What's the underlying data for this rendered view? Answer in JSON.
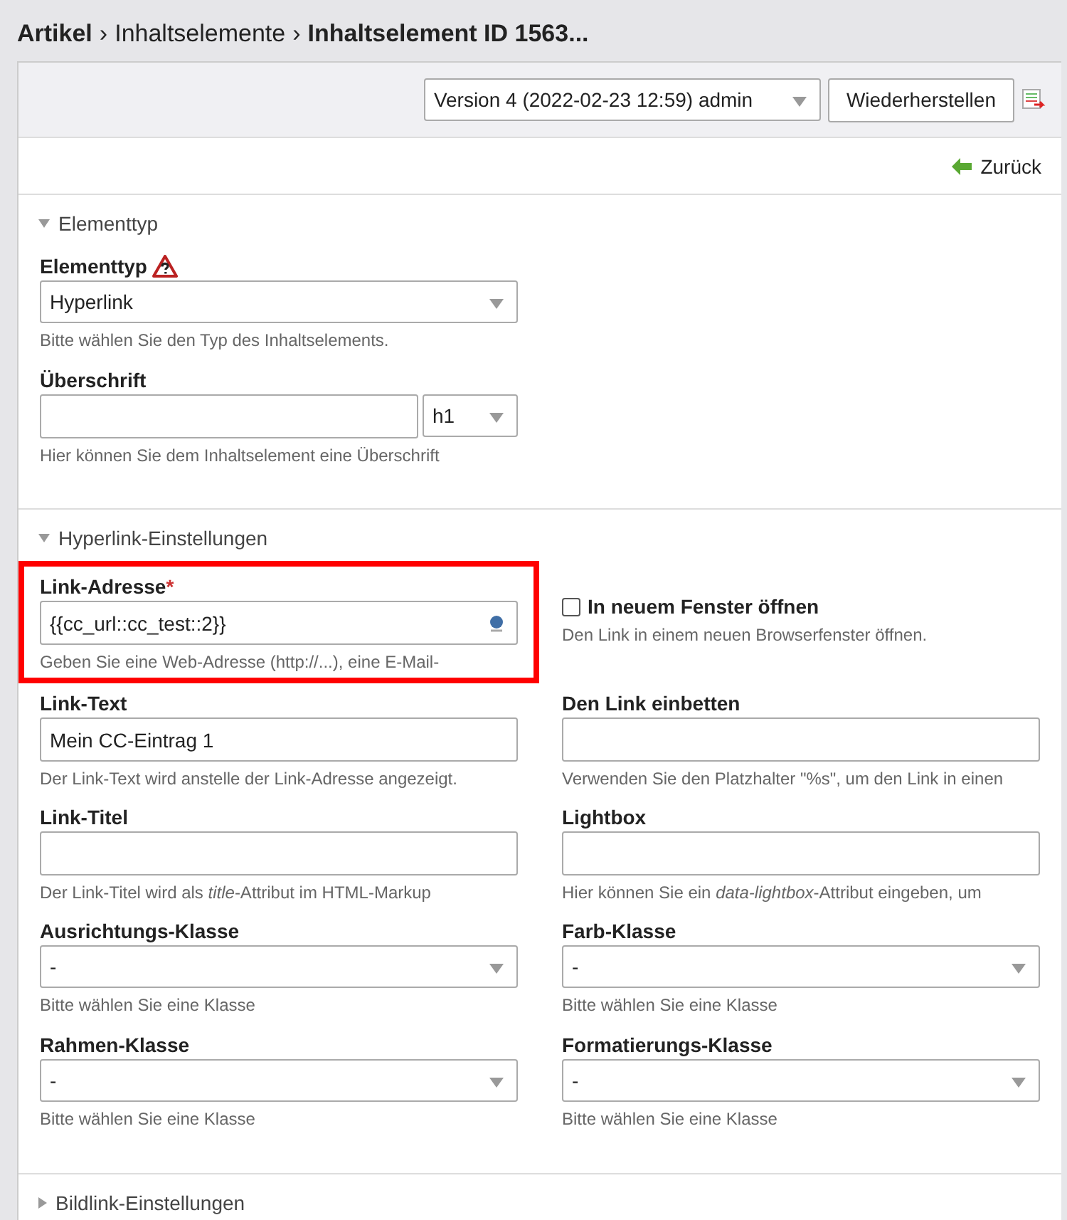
{
  "breadcrumb": [
    {
      "label": "Artikel",
      "bold": true
    },
    {
      "label": "Inhaltselemente",
      "bold": false
    },
    {
      "label": "Inhaltselement ID 1563...",
      "bold": true
    }
  ],
  "breadcrumb_separator": "›",
  "required_marker": "*",
  "toolbar": {
    "version_select": "Version 4 (2022-02-23 12:59) admin",
    "restore_button": "Wiederherstellen"
  },
  "back_link": "Zurück",
  "sections": [
    {
      "title": "Elementtyp",
      "expanded": true,
      "kind": "single",
      "fields": [
        {
          "kind": "select",
          "label": "Elementtyp",
          "warning": true,
          "value": "Hyperlink",
          "help": "Bitte wählen Sie den Typ des Inhaltselements."
        },
        {
          "kind": "text_select",
          "label": "Überschrift",
          "select_value": "h1",
          "help": "Hier können Sie dem Inhaltselement eine Überschrift"
        }
      ]
    },
    {
      "title": "Hyperlink-Einstellungen",
      "expanded": true,
      "kind": "two_column",
      "fields": [
        {
          "kind": "link",
          "label": "Link-Adresse",
          "required": true,
          "highlighted": true,
          "value": "{{cc_url::cc_test::2}}",
          "help": "Geben Sie eine Web-Adresse (http://...), eine E-Mail-"
        },
        {
          "kind": "checkbox",
          "label": "In neuem Fenster öffnen",
          "checked": false,
          "help": "Den Link in einem neuen Browserfenster öffnen."
        },
        {
          "kind": "text",
          "label": "Link-Text",
          "value": "Mein CC-Eintrag 1",
          "help": "Der Link-Text wird anstelle der Link-Adresse angezeigt."
        },
        {
          "kind": "text",
          "label": "Den Link einbetten",
          "help": "Verwenden Sie den Platzhalter \"%s\", um den Link in einen"
        },
        {
          "kind": "text",
          "label": "Link-Titel",
          "help": "Der Link-Titel wird als *title*-Attribut im HTML-Markup"
        },
        {
          "kind": "text",
          "label": "Lightbox",
          "help": "Hier können Sie ein *data-lightbox*-Attribut eingeben, um"
        },
        {
          "kind": "select",
          "label": "Ausrichtungs-Klasse",
          "value": "-",
          "help": "Bitte wählen Sie eine Klasse"
        },
        {
          "kind": "select",
          "label": "Farb-Klasse",
          "value": "-",
          "help": "Bitte wählen Sie eine Klasse"
        },
        {
          "kind": "select",
          "label": "Rahmen-Klasse",
          "value": "-",
          "help": "Bitte wählen Sie eine Klasse"
        },
        {
          "kind": "select",
          "label": "Formatierungs-Klasse",
          "value": "-",
          "help": "Bitte wählen Sie eine Klasse"
        }
      ]
    },
    {
      "title": "Bildlink-Einstellungen",
      "expanded": false
    }
  ]
}
